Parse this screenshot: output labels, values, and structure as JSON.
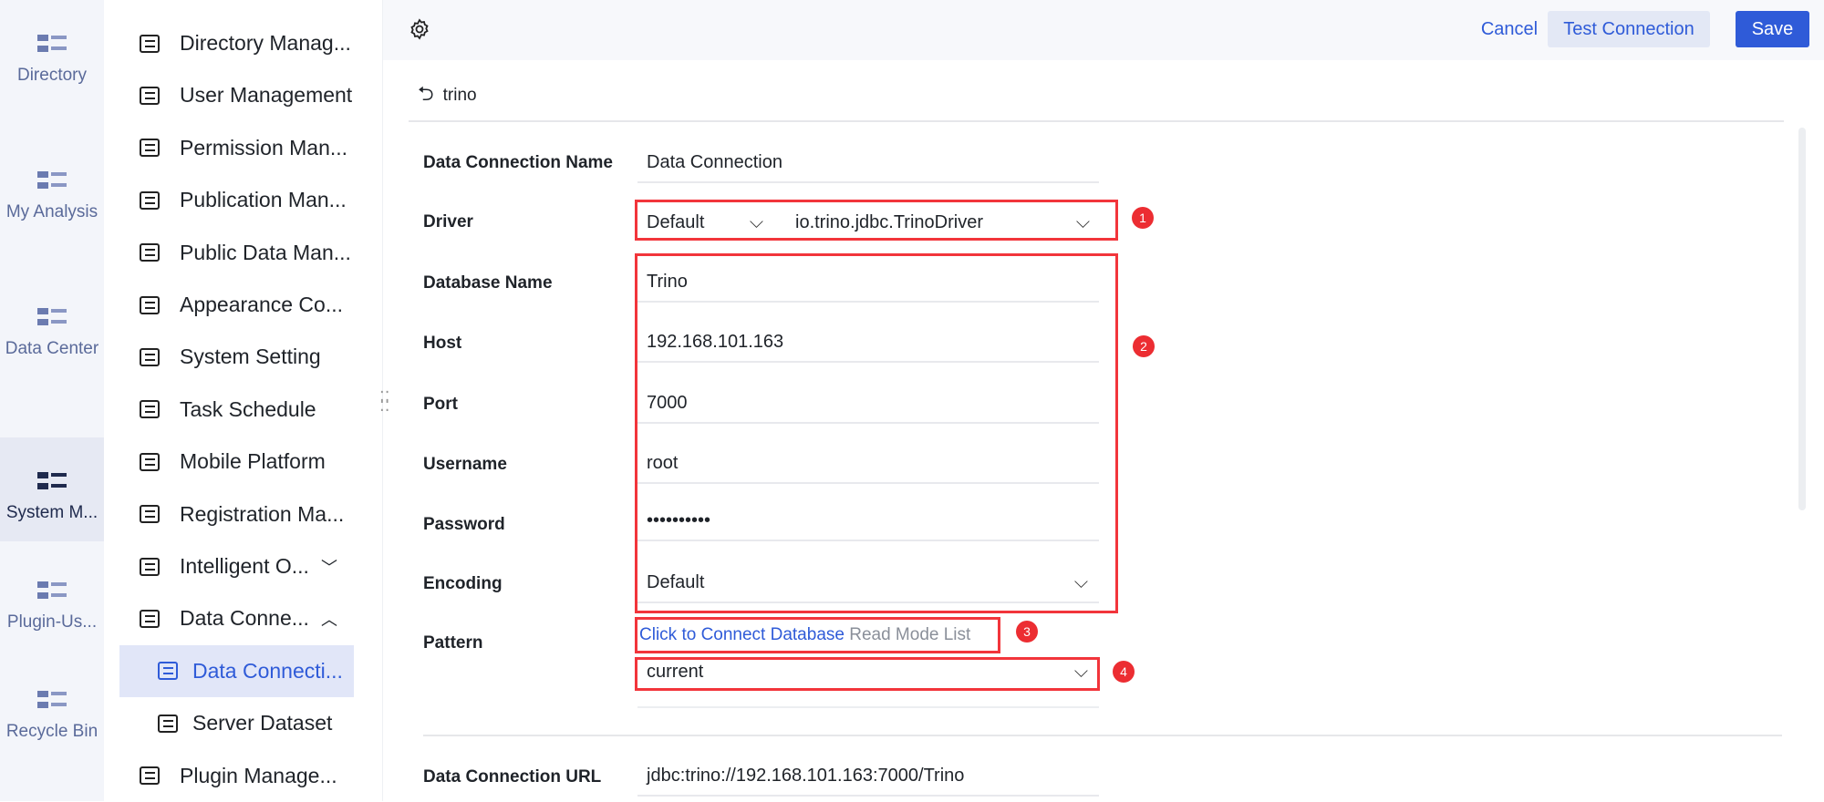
{
  "nav_primary": [
    {
      "label": "Directory",
      "icon": "directory-icon"
    },
    {
      "label": "My Analysis",
      "icon": "analysis-icon"
    },
    {
      "label": "Data Center",
      "icon": "data-center-icon"
    },
    {
      "label": "System M...",
      "icon": "system-management-icon",
      "active": true
    },
    {
      "label": "Plugin-Us...",
      "icon": "plugin-user-icon"
    },
    {
      "label": "Recycle Bin",
      "icon": "recycle-bin-icon"
    }
  ],
  "nav_secondary": [
    {
      "label": "Directory Manag...",
      "icon": "list-icon"
    },
    {
      "label": "User Management",
      "icon": "user-icon"
    },
    {
      "label": "Permission Man...",
      "icon": "shield-icon"
    },
    {
      "label": "Publication Man...",
      "icon": "publication-icon"
    },
    {
      "label": "Public Data Man...",
      "icon": "public-data-icon"
    },
    {
      "label": "Appearance Co...",
      "icon": "paint-roller-icon"
    },
    {
      "label": "System Setting",
      "icon": "gear-icon"
    },
    {
      "label": "Task Schedule",
      "icon": "timer-icon"
    },
    {
      "label": "Mobile Platform",
      "icon": "mobile-icon"
    },
    {
      "label": "Registration Ma...",
      "icon": "registration-icon"
    },
    {
      "label": "Intelligent O...",
      "icon": "intelligent-icon",
      "chevron": "down"
    },
    {
      "label": "Data Conne...",
      "icon": "paperclip-icon",
      "chevron": "up"
    },
    {
      "label": "Data Connecti...",
      "icon": "data-connection-icon",
      "sub": true,
      "active": true
    },
    {
      "label": "Server Dataset",
      "icon": "server-dataset-icon",
      "sub": true
    },
    {
      "label": "Plugin Manage...",
      "icon": "puzzle-icon"
    }
  ],
  "toolbar": {
    "cancel": "Cancel",
    "test": "Test Connection",
    "save": "Save"
  },
  "breadcrumb": {
    "back": "trino"
  },
  "form": {
    "name_label": "Data Connection Name",
    "name_value": "Data Connection",
    "driver_label": "Driver",
    "driver_type": "Default",
    "driver_class": "io.trino.jdbc.TrinoDriver",
    "db_label": "Database Name",
    "db_value": "Trino",
    "host_label": "Host",
    "host_value": "192.168.101.163",
    "port_label": "Port",
    "port_value": "7000",
    "user_label": "Username",
    "user_value": "root",
    "pass_label": "Password",
    "pass_value": "••••••••••",
    "enc_label": "Encoding",
    "enc_value": "Default",
    "pattern_label": "Pattern",
    "connect_link": "Click to Connect Database",
    "read_mode": "Read Mode List",
    "pattern_value": "current",
    "url_label": "Data Connection URL",
    "url_value": "jdbc:trino://192.168.101.163:7000/Trino"
  },
  "annotations": [
    "1",
    "2",
    "3",
    "4"
  ],
  "colors": {
    "accent": "#2f5bd8",
    "highlight": "#f2353b"
  }
}
